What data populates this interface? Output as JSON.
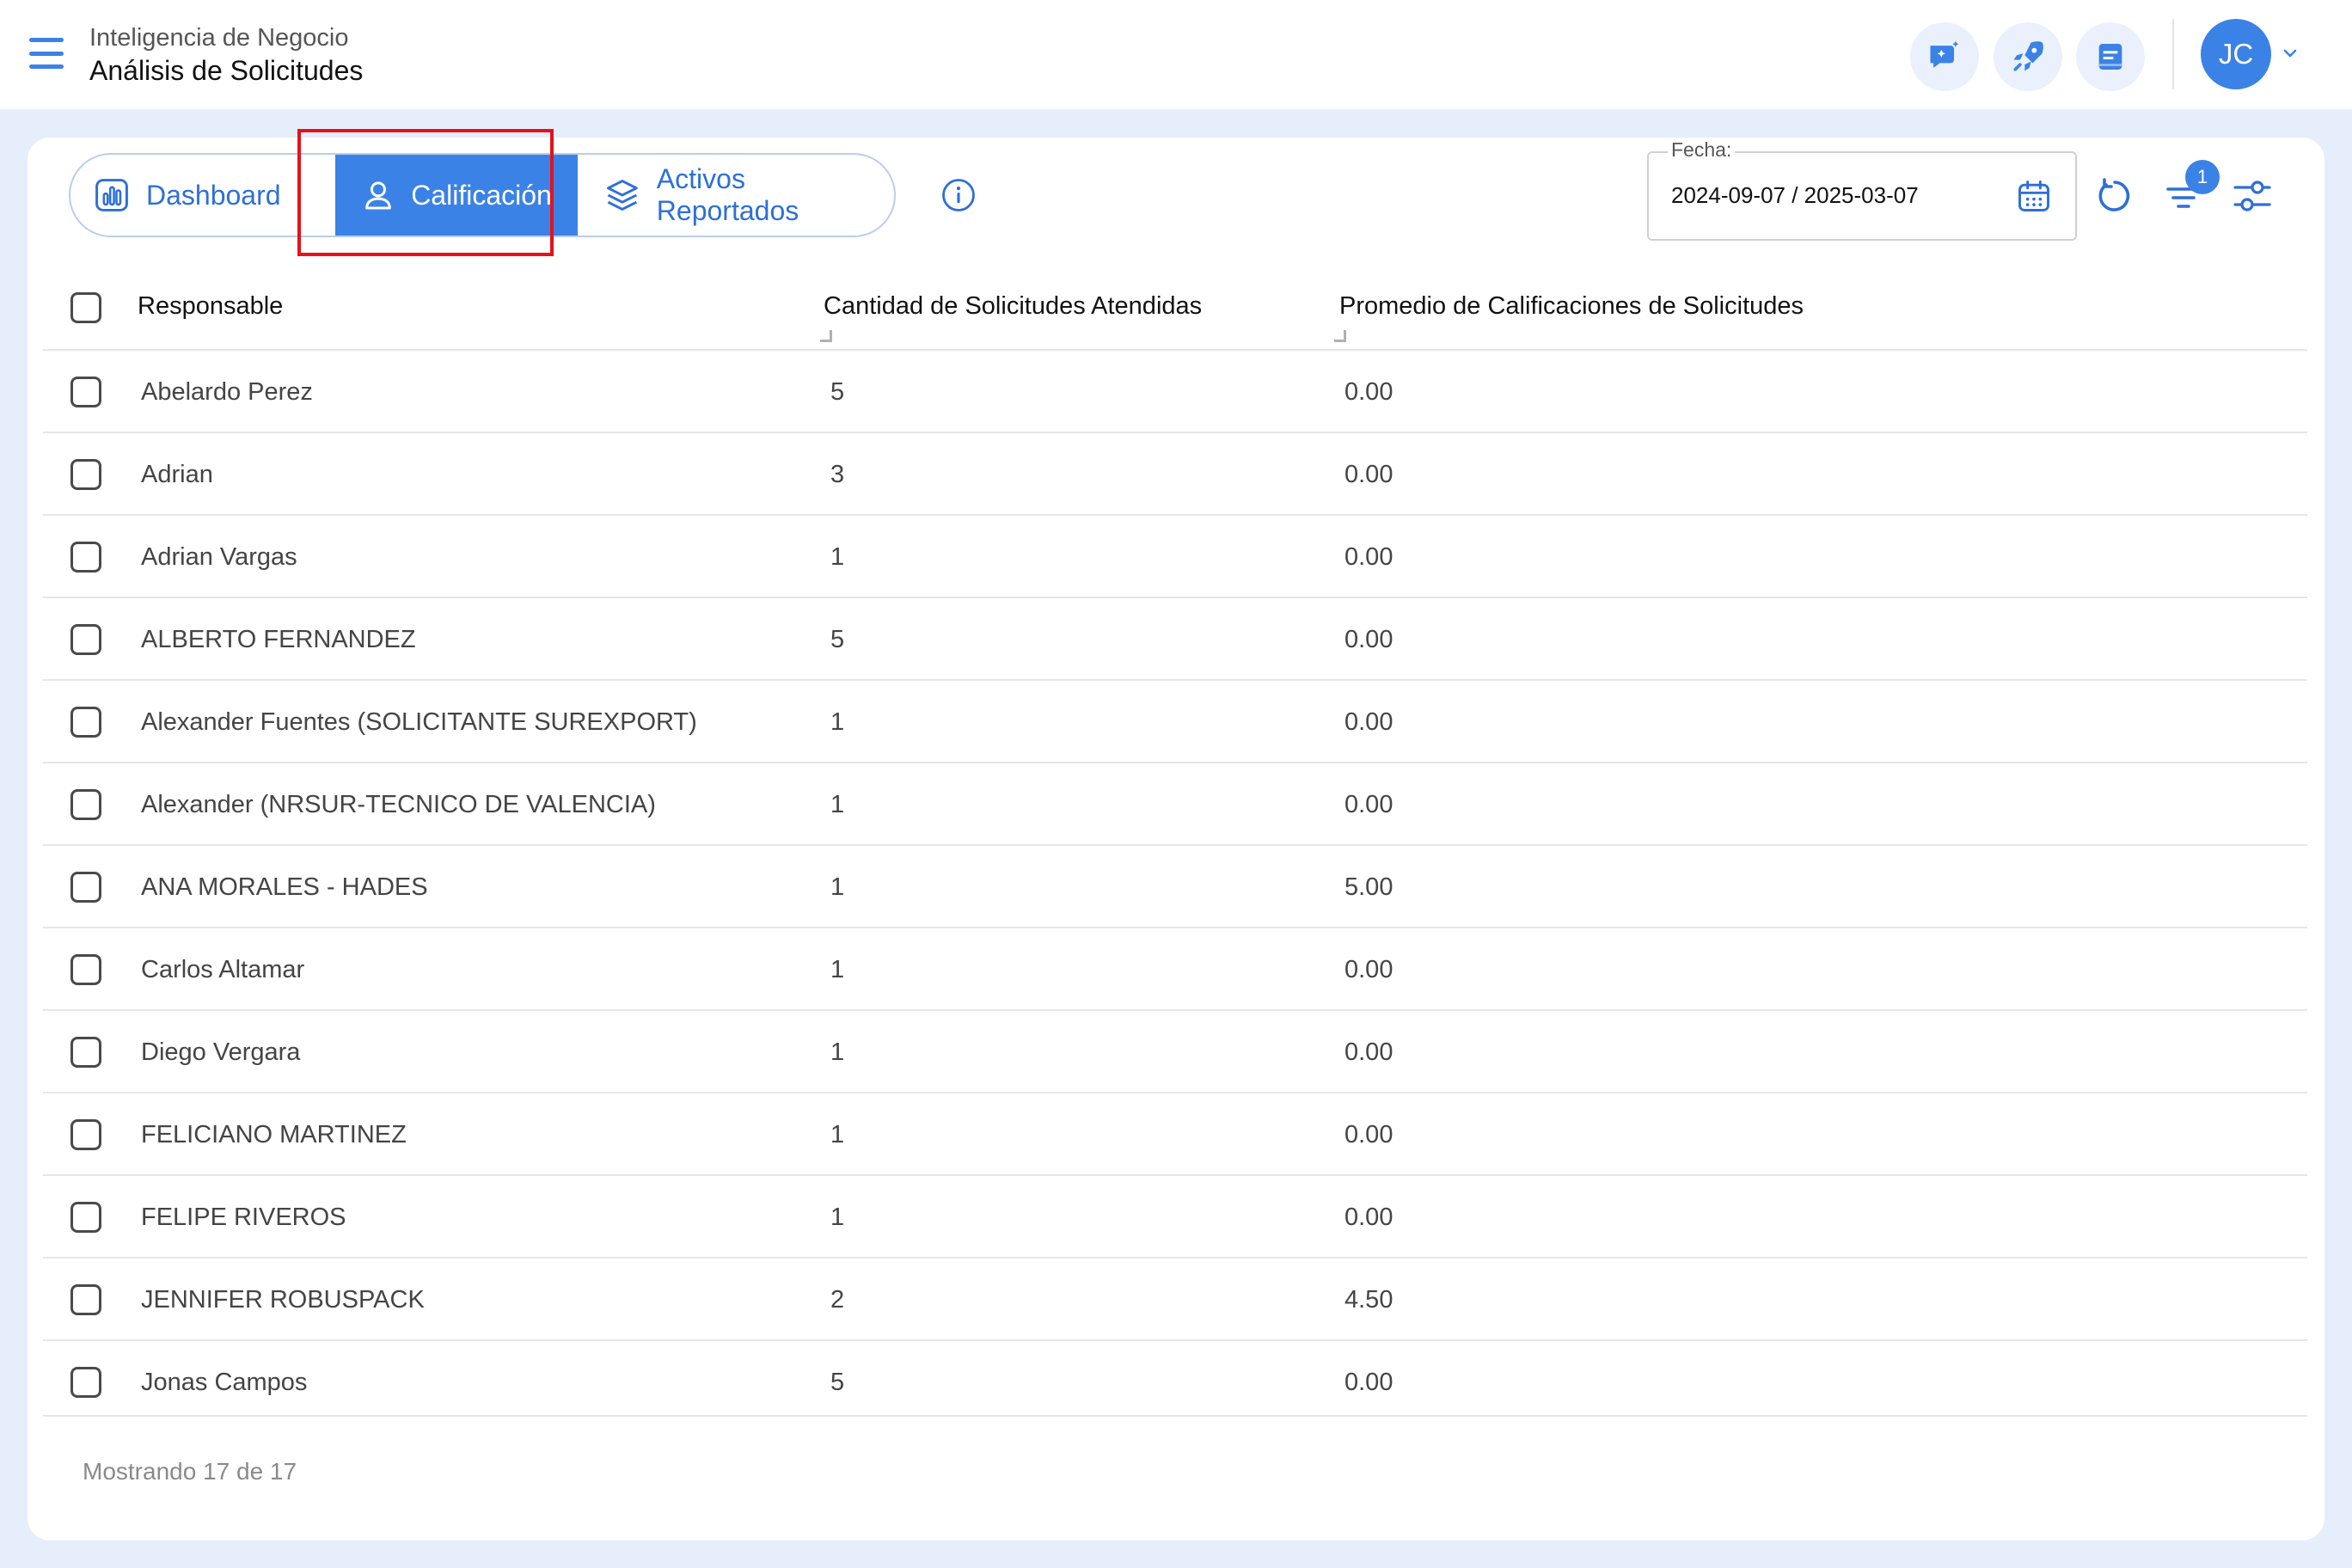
{
  "header": {
    "breadcrumb": "Inteligencia de Negocio",
    "title": "Análisis de Solicitudes",
    "avatar_initials": "JC",
    "icons": [
      "chat-sparkle-icon",
      "rocket-icon",
      "notes-icon"
    ]
  },
  "tabs": [
    {
      "label": "Dashboard",
      "icon": "bar-chart-icon",
      "active": false
    },
    {
      "label": "Calificación",
      "icon": "user-icon",
      "active": true
    },
    {
      "label": "Activos Reportados",
      "icon": "layers-icon",
      "active": false
    }
  ],
  "filters": {
    "date_label": "Fecha:",
    "date_value": "2024-09-07 / 2025-03-07",
    "filter_badge": "1"
  },
  "table": {
    "columns": [
      "Responsable",
      "Cantidad de Solicitudes Atendidas",
      "Promedio de Calificaciones de Solicitudes"
    ],
    "rows": [
      {
        "name": "Abelardo Perez",
        "qty": "5",
        "avg": "0.00"
      },
      {
        "name": "Adrian",
        "qty": "3",
        "avg": "0.00"
      },
      {
        "name": "Adrian Vargas",
        "qty": "1",
        "avg": "0.00"
      },
      {
        "name": "ALBERTO FERNANDEZ",
        "qty": "5",
        "avg": "0.00"
      },
      {
        "name": "Alexander Fuentes (SOLICITANTE SUREXPORT)",
        "qty": "1",
        "avg": "0.00"
      },
      {
        "name": "Alexander (NRSUR-TECNICO DE VALENCIA)",
        "qty": "1",
        "avg": "0.00"
      },
      {
        "name": "ANA MORALES - HADES",
        "qty": "1",
        "avg": "5.00"
      },
      {
        "name": "Carlos Altamar",
        "qty": "1",
        "avg": "0.00"
      },
      {
        "name": "Diego Vergara",
        "qty": "1",
        "avg": "0.00"
      },
      {
        "name": "FELICIANO MARTINEZ",
        "qty": "1",
        "avg": "0.00"
      },
      {
        "name": "FELIPE RIVEROS",
        "qty": "1",
        "avg": "0.00"
      },
      {
        "name": "JENNIFER ROBUSPACK",
        "qty": "2",
        "avg": "4.50"
      },
      {
        "name": "Jonas Campos",
        "qty": "5",
        "avg": "0.00"
      }
    ],
    "footer": "Mostrando 17 de 17"
  },
  "colors": {
    "accent": "#3b82e6",
    "highlight": "#e3121b",
    "background": "#e6eefb"
  }
}
